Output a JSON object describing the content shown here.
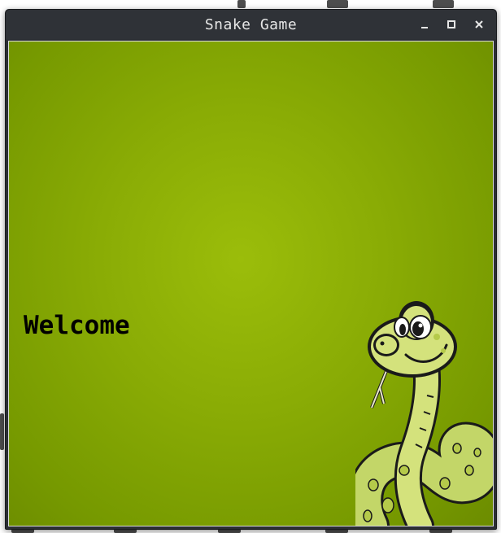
{
  "window": {
    "title": "Snake Game",
    "controls": {
      "minimize": "minimize-icon",
      "maximize": "maximize-icon",
      "close": "close-icon"
    }
  },
  "game": {
    "welcome_text": "Welcome",
    "mascot": "snake-mascot-illustration"
  },
  "colors": {
    "titlebar": "#2f3237",
    "title_text": "#e6e6e6",
    "canvas_center": "#9bbd0a",
    "canvas_edge": "#6c8c00",
    "welcome_text": "#000000"
  }
}
